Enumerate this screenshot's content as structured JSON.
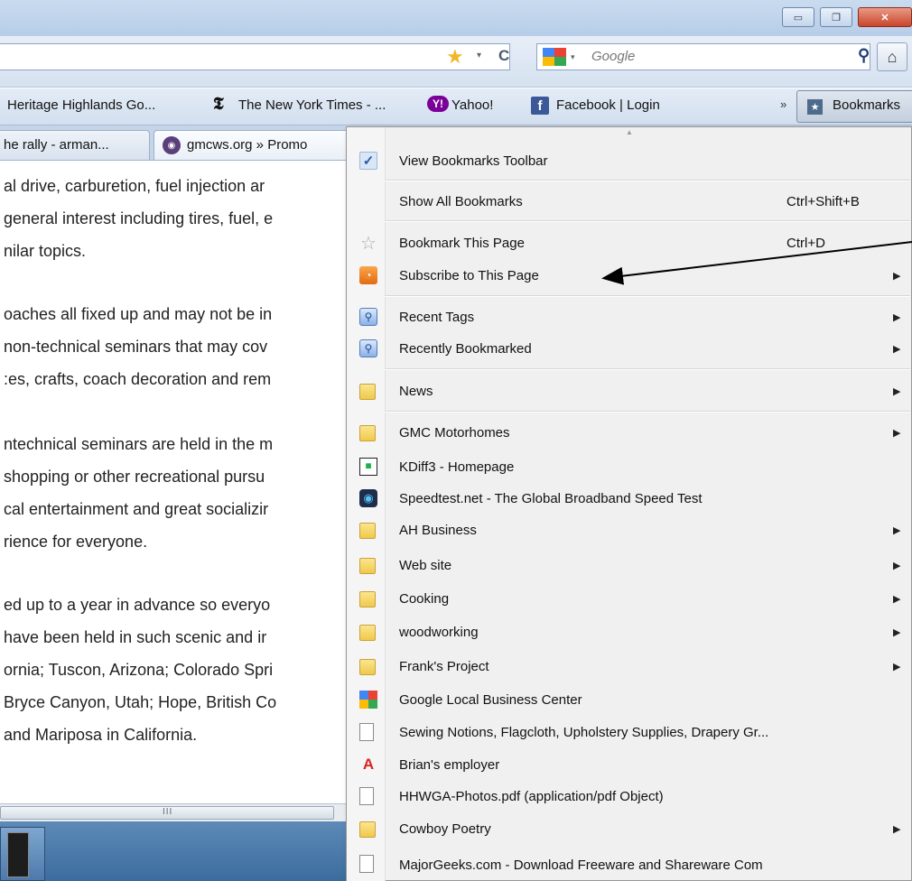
{
  "window": {
    "controls": {
      "minimize": "▭",
      "restore": "❐",
      "close": "✕"
    }
  },
  "navbar": {
    "search_placeholder": "Google",
    "icons": {
      "star": "star-icon",
      "reload": "reload-icon",
      "search": "search-icon",
      "home": "home-icon"
    }
  },
  "bookmarks_toolbar": {
    "items": [
      {
        "label": "Heritage Highlands Go..."
      },
      {
        "label": "The New York Times - ..."
      },
      {
        "label": "Yahoo!"
      },
      {
        "label": "Facebook | Login"
      }
    ],
    "overflow": "»",
    "bookmarks_button": "Bookmarks"
  },
  "tabs": [
    {
      "label": "he rally - arman..."
    },
    {
      "label": "gmcws.org » Promo"
    }
  ],
  "content": {
    "lines": [
      "al drive, carburetion, fuel injection ar",
      "general interest including tires, fuel, e",
      "nilar topics.",
      "oaches all fixed up and may not be in",
      "non-technical seminars that may cov",
      ":es, crafts, coach decoration and rem",
      "ntechnical seminars are held in the m",
      "shopping or other recreational pursu",
      "cal entertainment and great socializir",
      "rience for everyone.",
      "ed up to a year in advance so everyo",
      "have been held in such scenic and ir",
      "ornia; Tuscon, Arizona; Colorado Spri",
      "Bryce Canyon, Utah; Hope, British Co",
      "and Mariposa in California."
    ],
    "scroll_grip": "III"
  },
  "menu": {
    "items": [
      {
        "label": "View Bookmarks Toolbar",
        "icon": "check-icon",
        "checked": true
      },
      {
        "label": "Show All Bookmarks",
        "shortcut": "Ctrl+Shift+B"
      },
      {
        "label": "Bookmark This Page",
        "shortcut": "Ctrl+D",
        "icon": "star-outline-icon"
      },
      {
        "label": "Subscribe to This Page",
        "icon": "rss-icon",
        "submenu": true
      },
      {
        "label": "Recent Tags",
        "icon": "tag-icon",
        "submenu": true
      },
      {
        "label": "Recently Bookmarked",
        "icon": "tag-icon",
        "submenu": true
      },
      {
        "label": "News",
        "icon": "folder-icon",
        "submenu": true
      },
      {
        "label": "GMC Motorhomes",
        "icon": "folder-icon",
        "submenu": true
      },
      {
        "label": "KDiff3 - Homepage",
        "icon": "kdiff-icon"
      },
      {
        "label": "Speedtest.net - The Global Broadband Speed Test",
        "icon": "speedtest-icon"
      },
      {
        "label": "AH Business",
        "icon": "folder-icon",
        "submenu": true
      },
      {
        "label": "Web site",
        "icon": "folder-icon",
        "submenu": true
      },
      {
        "label": "Cooking",
        "icon": "folder-icon",
        "submenu": true
      },
      {
        "label": "woodworking",
        "icon": "folder-icon",
        "submenu": true
      },
      {
        "label": "Frank's Project",
        "icon": "folder-icon",
        "submenu": true
      },
      {
        "label": "Google Local Business Center",
        "icon": "google-icon"
      },
      {
        "label": "Sewing Notions, Flagcloth, Upholstery Supplies, Drapery Gr...",
        "icon": "page-icon"
      },
      {
        "label": "Brian's employer",
        "icon": "adobe-icon"
      },
      {
        "label": "HHWGA-Photos.pdf (application/pdf Object)",
        "icon": "page-icon"
      },
      {
        "label": "Cowboy Poetry",
        "icon": "folder-icon",
        "submenu": true
      },
      {
        "label": "MajorGeeks.com - Download Freeware and Shareware Com",
        "icon": "page-icon"
      }
    ]
  },
  "colors": {
    "accent": "#f2b62a",
    "rss": "#e36b10",
    "folder": "#f0c94c",
    "facebook": "#3b5998",
    "yahoo": "#7b0099"
  }
}
